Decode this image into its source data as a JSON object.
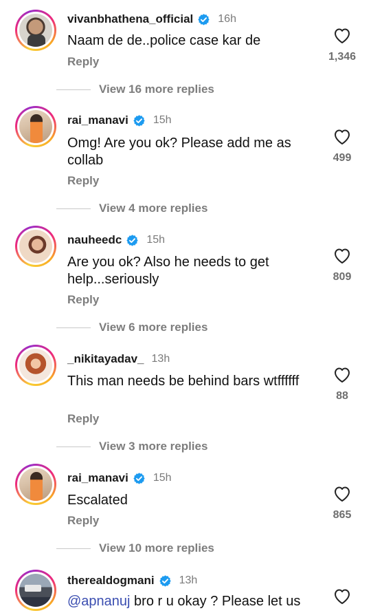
{
  "comments": [
    {
      "username": "vivanbhathena_official",
      "time": "16h",
      "text": "Naam de de..police case kar de",
      "reply_label": "Reply",
      "likes": "1,346",
      "more_replies": "View 16 more replies"
    },
    {
      "username": "rai_manavi",
      "time": "15h",
      "text": "Omg! Are you ok? Please add me as collab",
      "reply_label": "Reply",
      "likes": "499",
      "more_replies": "View 4 more replies"
    },
    {
      "username": "nauheedc",
      "time": "15h",
      "text": "Are you ok? Also he needs to get help...seriously",
      "reply_label": "Reply",
      "likes": "809",
      "more_replies": "View 6 more replies"
    },
    {
      "username": "_nikitayadav_",
      "time": "13h",
      "text": "This man needs be behind bars wtffffff",
      "reply_label": "Reply",
      "likes": "88",
      "more_replies": "View 3 more replies"
    },
    {
      "username": "rai_manavi",
      "time": "15h",
      "text": "Escalated",
      "reply_label": "Reply",
      "likes": "865",
      "more_replies": "View 10 more replies"
    },
    {
      "username": "therealdogmani",
      "time": "13h",
      "mention": "@apnanuj",
      "text": " bro r u okay ? Please let us"
    }
  ],
  "icons": {
    "verified": "verified-badge-icon",
    "like": "heart-outline-icon"
  },
  "colors": {
    "verified": "#1d9bf0",
    "mention": "#3a4db0",
    "muted": "#7d7d7d"
  }
}
